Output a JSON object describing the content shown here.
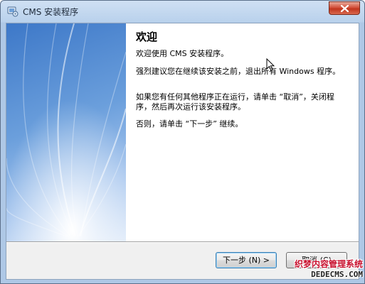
{
  "window": {
    "title": "CMS 安装程序"
  },
  "icons": {
    "app": "installer-icon",
    "close": "close-icon",
    "cursor": "mouse-pointer-icon"
  },
  "page": {
    "heading": "欢迎",
    "para1": "欢迎使用 CMS  安装程序。",
    "para2": "强烈建议您在继续该安装之前，退出所有 Windows 程序。",
    "para3": "如果您有任何其他程序正在运行，请单击 “取消”，关闭程序，然后再次运行该安装程序。",
    "para4": "否则，请单击 “下一步” 继续。"
  },
  "buttons": {
    "next_label": "下一步 (N) >",
    "cancel_label": "取消 (C)"
  },
  "watermark": {
    "line1": "织梦内容管理系统",
    "line2": "DEDECMS.COM"
  },
  "colors": {
    "banner_blue": "#3d78c8",
    "close_red": "#c0351e",
    "watermark_red": "#c8102e"
  }
}
